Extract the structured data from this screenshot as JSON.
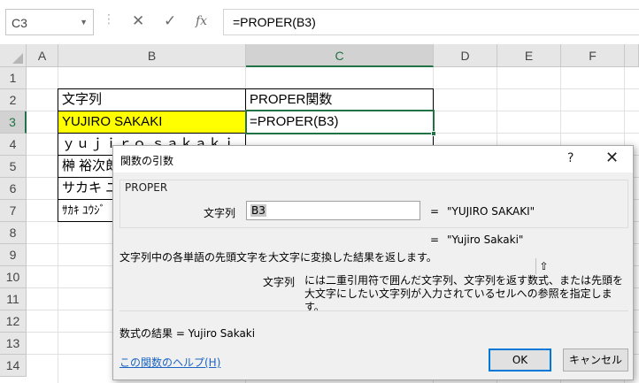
{
  "formula_bar": {
    "name_box": "C3",
    "cancel_icon": "✕",
    "enter_icon": "✓",
    "fx_label": "fx",
    "formula": "=PROPER(B3)"
  },
  "columns": [
    "A",
    "B",
    "C",
    "D",
    "E",
    "F"
  ],
  "rows": [
    "1",
    "2",
    "3",
    "4",
    "5",
    "6",
    "7",
    "8",
    "9",
    "10",
    "11",
    "12",
    "13",
    "14"
  ],
  "cells": {
    "B2": "文字列",
    "C2": "PROPER関数",
    "B3": "YUJIRO SAKAKI",
    "C3": "=PROPER(B3)",
    "B4": "ｙｕｊｉｒｏ ｓａｋａｋｉ",
    "B5": "榊 裕次郎",
    "B6": "サカキ ユ",
    "B7": "ｻｶｷ ﾕｳｼﾞ"
  },
  "colors": {
    "selection": "#217346",
    "highlight": "#ffff00",
    "ok_border": "#0078d7",
    "link": "#1a63c2"
  },
  "dialog": {
    "title": "関数の引数",
    "help_button": "?",
    "close_button": "✕",
    "function_name": "PROPER",
    "arg_label": "文字列",
    "arg_value": "B3",
    "arg_ref_icon": "⇧",
    "arg_eq": "=",
    "arg_result": "\"YUJIRO SAKAKI\"",
    "result_eq": "=",
    "result_value": "\"Yujiro Sakaki\"",
    "description": "文字列中の各単語の先頭文字を大文字に変換した結果を返します。",
    "arg_desc_name": "文字列",
    "arg_desc_text": "には二重引用符で囲んだ文字列、文字列を返す数式、または先頭を大文字にしたい文字列が入力されているセルへの参照を指定します。",
    "formula_result": "数式の結果 =   Yujiro Sakaki",
    "help_link": "この関数のヘルプ(H)",
    "ok": "OK",
    "cancel": "キャンセル"
  }
}
